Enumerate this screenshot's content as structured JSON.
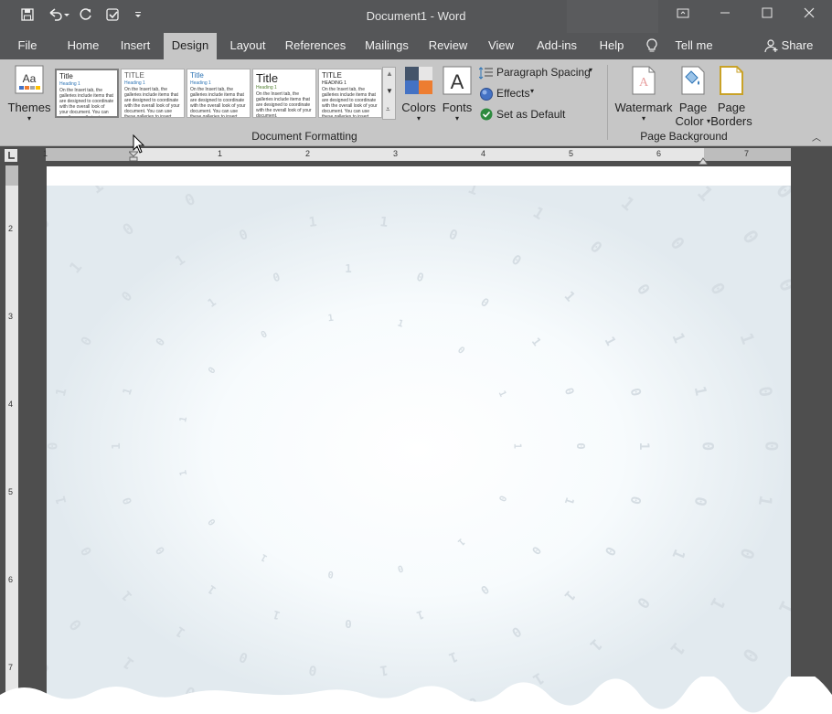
{
  "window": {
    "title": "Document1 - Word"
  },
  "qat": {
    "save": "save-icon",
    "undo": "undo-icon",
    "redo": "redo-icon",
    "touch": "touch-mode-icon",
    "customize": "customize-qat-icon"
  },
  "window_controls": {
    "ribbon_display": "ribbon-display-icon",
    "minimize": "minimize-icon",
    "maximize": "maximize-icon",
    "close": "close-icon"
  },
  "tabs": [
    "File",
    "Home",
    "Insert",
    "Design",
    "Layout",
    "References",
    "Mailings",
    "Review",
    "View",
    "Add-ins",
    "Help"
  ],
  "active_tab": "Design",
  "tell_me": "Tell me",
  "share": "Share",
  "ribbon": {
    "themes_label": "Themes",
    "gallery": [
      {
        "title": "Title",
        "heading": "Heading 1",
        "body": "On the Insert tab, the galleries include items that are designed to coordinate with the overall look of your document. You can use these galleries to insert tables, headers, footers, lists, cover pages."
      },
      {
        "title": "TITLE",
        "heading": "Heading 1",
        "body": "On the Insert tab, the galleries include items that are designed to coordinate with the overall look of your document. You can use these galleries to insert tables."
      },
      {
        "title": "Title",
        "heading": "Heading 1",
        "body": "On the Insert tab, the galleries include items that are designed to coordinate with the overall look of your document. You can use these galleries to insert tables, headers, lists, cover pages."
      },
      {
        "title": "Title",
        "heading": "Heading 1",
        "body": "On the Insert tab, the galleries include items that are designed to coordinate with the overall look of your document."
      },
      {
        "title": "TITLE",
        "heading": "HEADING 1",
        "body": "On the Insert tab, the galleries include items that are designed to coordinate with the overall look of your document. You can use these galleries to insert."
      }
    ],
    "colors_label": "Colors",
    "fonts_label": "Fonts",
    "paragraph_spacing": "Paragraph Spacing",
    "effects": "Effects",
    "set_default": "Set as Default",
    "document_formatting": "Document Formatting",
    "watermark": "Watermark",
    "page_color_1": "Page",
    "page_color_2": "Color",
    "page_borders_1": "Page",
    "page_borders_2": "Borders",
    "page_background": "Page Background"
  },
  "ruler": {
    "h_numbers": [
      "1",
      "1",
      "2",
      "3",
      "4",
      "5",
      "6",
      "7"
    ],
    "v_numbers": [
      "2",
      "3",
      "4",
      "5",
      "6",
      "7"
    ]
  },
  "watermark_text": "1101001011001101010010110011011001"
}
